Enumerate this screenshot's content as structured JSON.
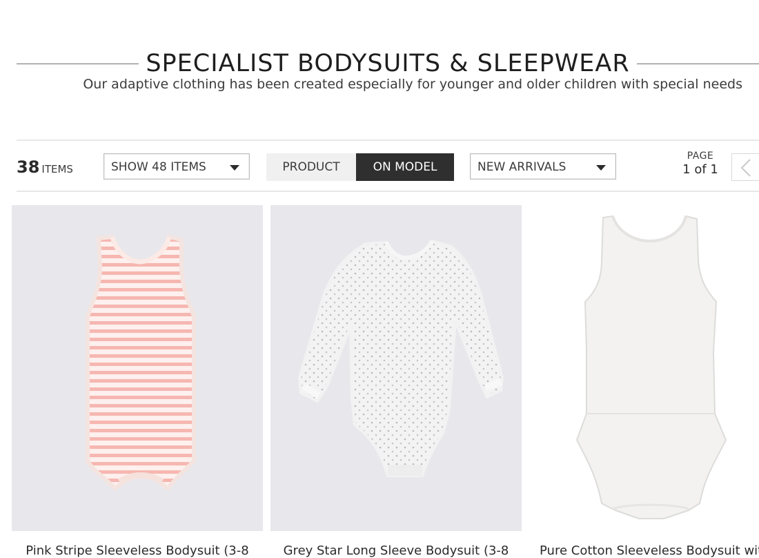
{
  "header": {
    "title": "SPECIALIST BODYSUITS & SLEEPWEAR",
    "subtitle": "Our adaptive clothing has been created especially for younger and older children with special needs"
  },
  "toolbar": {
    "item_count": "38",
    "item_count_label": "ITEMS",
    "show_select": {
      "value": "SHOW 48 ITEMS"
    },
    "view_toggle": {
      "product_label": "PRODUCT",
      "model_label": "ON MODEL",
      "active": "ON MODEL"
    },
    "sort_select": {
      "value": "NEW ARRIVALS"
    },
    "pager": {
      "label": "PAGE",
      "value": "1 of 1"
    },
    "prev_icon": "chevron-left-icon"
  },
  "products": [
    {
      "name": "Pink Stripe Sleeveless Bodysuit (3-8",
      "image_bg": "#e8e7ec",
      "image": "pink-stripe-bodysuit"
    },
    {
      "name": "Grey Star Long Sleeve Bodysuit (3-8",
      "image_bg": "#e8e7ec",
      "image": "grey-star-longsleeve-bodysuit"
    },
    {
      "name": "Pure Cotton Sleeveless Bodysuit with",
      "image_bg": "#ffffff",
      "image": "white-sleeveless-bodysuit"
    }
  ],
  "colors": {
    "active_toggle_bg": "#2f2f2f",
    "inactive_toggle_bg": "#f0f0f0",
    "stripe_pink": "#f6b7b1"
  }
}
